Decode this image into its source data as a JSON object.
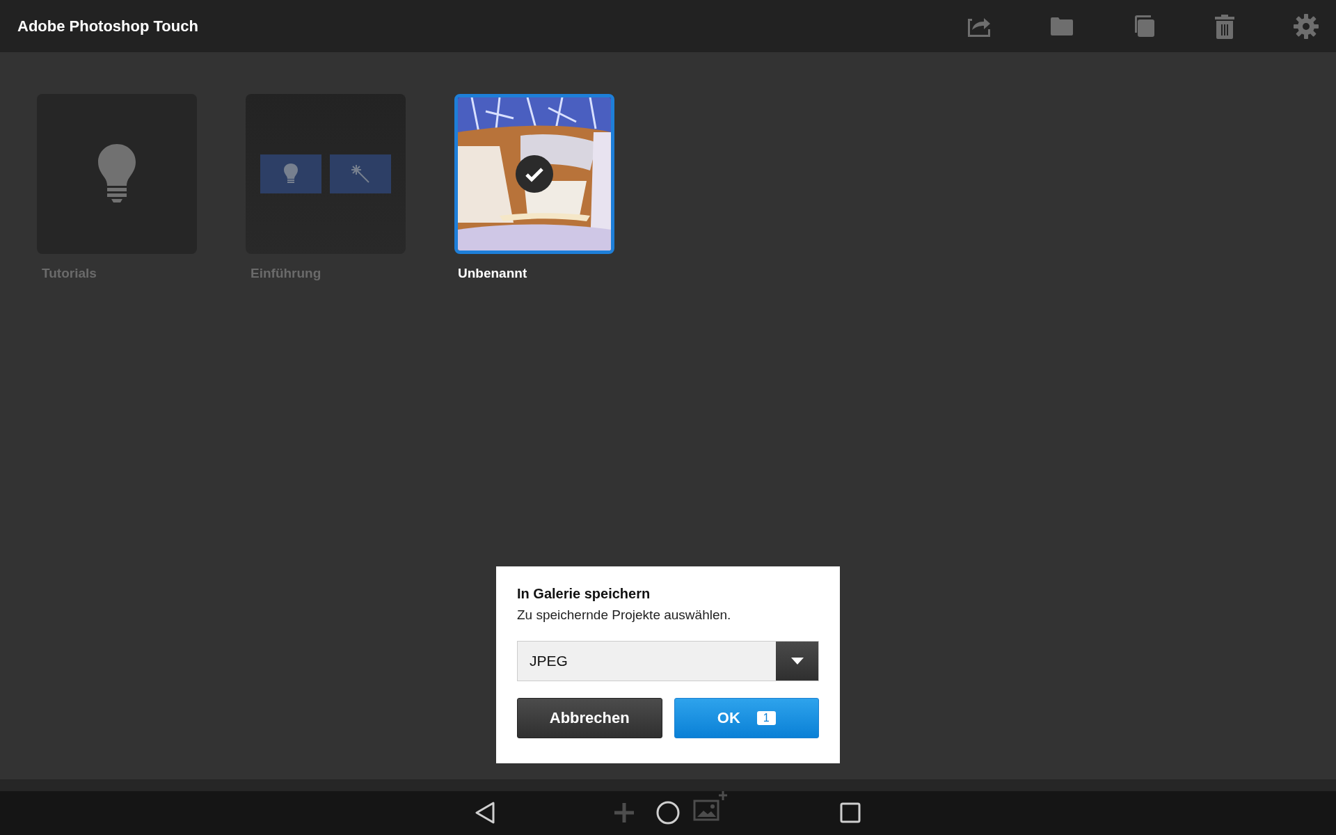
{
  "app_bar": {
    "title": "Adobe Photoshop Touch"
  },
  "projects": [
    {
      "kind": "tutorials",
      "label": "Tutorials",
      "selected": false
    },
    {
      "kind": "intro",
      "label": "Einführung",
      "selected": false
    },
    {
      "kind": "picture",
      "label": "Unbenannt",
      "selected": true
    }
  ],
  "dialog": {
    "title": "In Galerie speichern",
    "message": "Zu speichernde Projekte auswählen.",
    "format": {
      "value": "JPEG"
    },
    "buttons": [
      {
        "kind": "cancel",
        "label": "Abbrechen"
      },
      {
        "kind": "ok",
        "label": "OK",
        "badge": "1"
      }
    ]
  }
}
